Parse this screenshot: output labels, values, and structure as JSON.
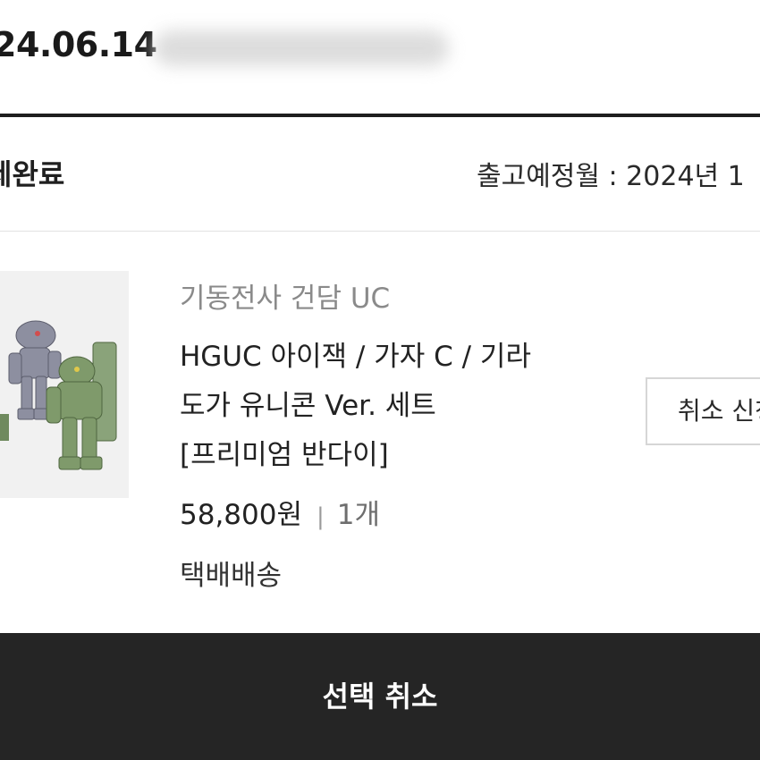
{
  "order": {
    "date": "24.06.14",
    "status": "제완료",
    "ship_date": "출고예정월 : 2024년 1"
  },
  "product": {
    "brand": "기동전사 건담 UC",
    "name_line1": "HGUC 아이잭 / 가자 C / 기라",
    "name_line2": "도가 유니콘 Ver. 세트",
    "name_line3": "[프리미엄 반다이]",
    "price": "58,800원",
    "separator": "|",
    "quantity": "1개",
    "delivery": "택배배송",
    "image_icon": "gunpla-model-kit-image"
  },
  "actions": {
    "cancel_request_label": "취소 신청",
    "select_cancel_label": "선택 취소"
  },
  "colors": {
    "bottom_bar": "#252525",
    "rule": "#1e1e1e",
    "muted_text": "#8a8a8a"
  }
}
